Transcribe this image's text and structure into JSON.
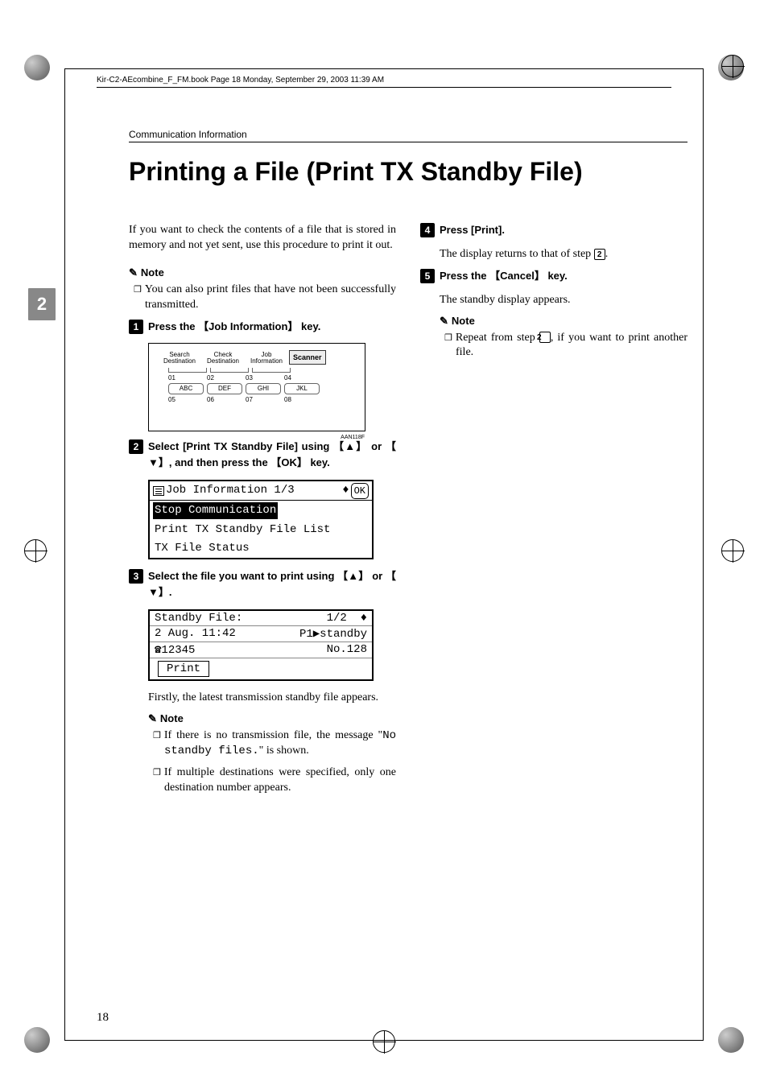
{
  "book_header": "Kir-C2-AEcombine_F_FM.book  Page 18  Monday, September 29, 2003  11:39 AM",
  "running_header": "Communication Information",
  "main_title": "Printing a File (Print TX Standby File)",
  "side_tab": "2",
  "page_number": "18",
  "intro": "If you want to check the contents of a file that is stored in memory and not yet sent, use this procedure to print it out.",
  "note_label": "Note",
  "note1_item": "You can also print files that have not been successfully transmitted.",
  "steps": {
    "s1": {
      "pre": "Press the ",
      "key": "Job Information",
      "post": " key."
    },
    "s2": {
      "pre": "Select ",
      "bold1": "[Print TX Standby File]",
      "mid1": " using ",
      "mid2": " or ",
      "mid3": ", and then press the ",
      "key": "OK",
      "post": " key."
    },
    "s3": {
      "pre": "Select the file you want to print using ",
      "mid": " or ",
      "post": "."
    },
    "s4": {
      "pre": "Press ",
      "bold": "[Print]",
      "post": "."
    },
    "s5": {
      "pre": "Press the ",
      "key": "Cancel",
      "post": " key."
    }
  },
  "panel": {
    "labels": [
      "Search Destination",
      "Check Destination",
      "Job Information"
    ],
    "scanner": "Scanner",
    "row1": [
      "01",
      "02",
      "03",
      "04"
    ],
    "keys": [
      "ABC",
      "DEF",
      "GHI",
      "JKL"
    ],
    "row2": [
      "05",
      "06",
      "07",
      "08"
    ],
    "code": "AAN118F"
  },
  "lcd1": {
    "title": "Job Information 1/3",
    "ok": "OK",
    "items": [
      "Stop Communication",
      "Print TX Standby File List",
      "TX File Status"
    ]
  },
  "lcd2": {
    "title_left": "Standby File:",
    "title_right": "1/2",
    "r2_left": "2 Aug. 11:42",
    "r2_right": "P1▶standby",
    "r3_left": "☎12345",
    "r3_right": "No.128",
    "print": "Print"
  },
  "after3": "Firstly, the latest transmission standby file appears.",
  "note3a_pre": "If there is no transmission file, the message \"",
  "note3a_mono": "No standby files.",
  "note3a_post": "\" is shown.",
  "note3b": "If multiple destinations were specified, only one destination number appears.",
  "after4_pre": "The display returns to that of step ",
  "after4_ref": "2",
  "after4_post": ".",
  "after5": "The standby display appears.",
  "note5_pre": "Repeat from step ",
  "note5_ref": "2",
  "note5_post": ", if you want to print another file."
}
